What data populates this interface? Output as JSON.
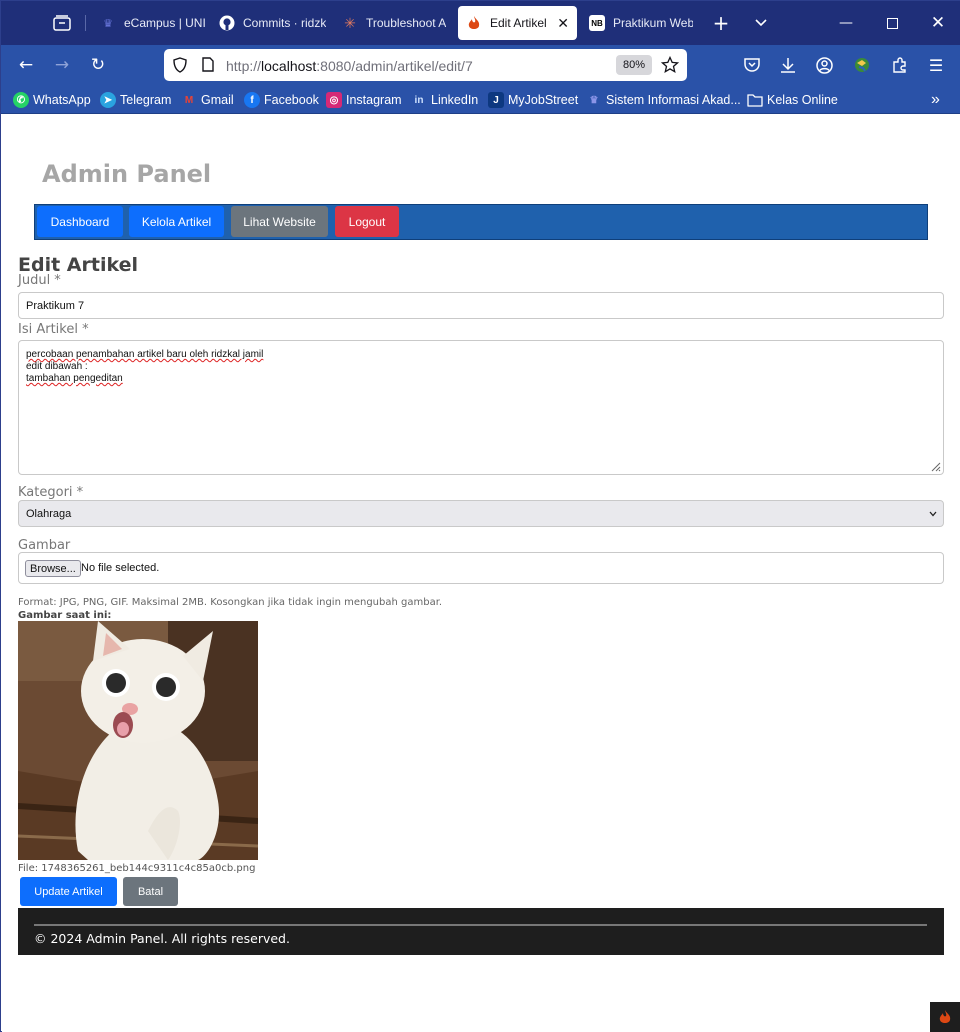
{
  "browser": {
    "tabs": [
      {
        "label": "eCampus | UNI",
        "icon": "campus-icon",
        "active": false
      },
      {
        "label": "Commits · ridzk",
        "icon": "github-icon",
        "active": false
      },
      {
        "label": "Troubleshoot A",
        "icon": "claude-icon",
        "active": false
      },
      {
        "label": "Edit Artikel",
        "icon": "codeigniter-icon",
        "active": true
      },
      {
        "label": "Praktikum Web",
        "icon": "notion-icon",
        "active": false
      }
    ],
    "url": {
      "prefix": "http://",
      "host": "localhost",
      "path": ":8080/admin/artikel/edit/7"
    },
    "zoom": "80%",
    "bookmarks": [
      {
        "label": "WhatsApp",
        "icon": "whatsapp-icon",
        "color": "#25d366"
      },
      {
        "label": "Telegram",
        "icon": "telegram-icon",
        "color": "#2aa3df"
      },
      {
        "label": "Gmail",
        "icon": "gmail-icon",
        "color": "#ea4335"
      },
      {
        "label": "Facebook",
        "icon": "facebook-icon",
        "color": "#1877f2"
      },
      {
        "label": "Instagram",
        "icon": "instagram-icon",
        "color": "#d62976"
      },
      {
        "label": "LinkedIn",
        "icon": "linkedin-icon",
        "color": "#0a66c2"
      },
      {
        "label": "MyJobStreet",
        "icon": "jobstreet-icon",
        "color": "#0d3880"
      },
      {
        "label": "Sistem Informasi Akad...",
        "icon": "campus-icon",
        "color": "#3a3a9a"
      },
      {
        "label": "Kelas Online",
        "icon": "folder-icon",
        "color": "#ffffff"
      }
    ]
  },
  "page": {
    "brand": "Admin Panel",
    "menu": [
      {
        "label": "Dashboard",
        "color": "#0d6efd"
      },
      {
        "label": "Kelola Artikel",
        "color": "#0d6efd"
      },
      {
        "label": "Lihat Website",
        "color": "#6c757d"
      },
      {
        "label": "Logout",
        "color": "#dc3545"
      }
    ],
    "heading": "Edit Artikel",
    "form": {
      "judul_label": "Judul *",
      "judul_value": "Praktikum 7",
      "isi_label": "Isi Artikel *",
      "isi_lines": [
        "percobaan penambahan artikel baru oleh ridzkal jamil",
        "edit dibawah :",
        "tambahan pengeditan"
      ],
      "kategori_label": "Kategori *",
      "kategori_value": "Olahraga",
      "gambar_label": "Gambar",
      "browse_label": "Browse...",
      "file_status": "No file selected.",
      "format_hint": "Format: JPG, PNG, GIF. Maksimal 2MB. Kosongkan jika tidak ingin mengubah gambar.",
      "current_label": "Gambar saat ini:",
      "file_name": "File: 1748365261_beb144c9311c4c85a0cb.png",
      "update_button": "Update Artikel",
      "cancel_button": "Batal"
    },
    "footer": "© 2024 Admin Panel. All rights reserved."
  }
}
